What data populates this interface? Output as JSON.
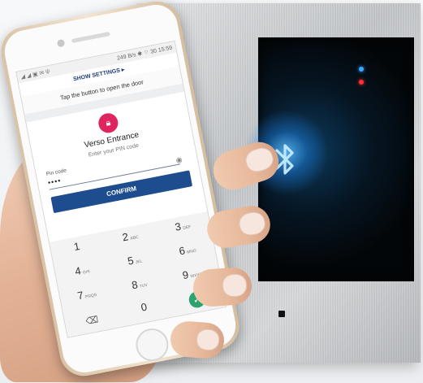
{
  "status_bar": {
    "left_icons": [
      "signal-icon",
      "signal-icon",
      "image-icon",
      "mail-icon",
      "usb-icon"
    ],
    "right_text": "249 B/s ✱ ⌔ 30 15:59"
  },
  "app": {
    "settings_label": "SHOW SETTINGS ▸",
    "instruction": "Tap the button to open the door",
    "entrance_title": "Verso Entrance",
    "entrance_subtitle": "Enter your PIN code",
    "pin_label": "Pin code",
    "pin_value": "••••",
    "confirm_label": "CONFIRM"
  },
  "keypad": [
    {
      "digit": "1",
      "letters": ""
    },
    {
      "digit": "2",
      "letters": "ABC"
    },
    {
      "digit": "3",
      "letters": "DEF"
    },
    {
      "digit": "4",
      "letters": "GHI"
    },
    {
      "digit": "5",
      "letters": "JKL"
    },
    {
      "digit": "6",
      "letters": "MNO"
    },
    {
      "digit": "7",
      "letters": "PRQS"
    },
    {
      "digit": "8",
      "letters": "TUV"
    },
    {
      "digit": "9",
      "letters": "WXYZ"
    },
    {
      "digit": "⌫",
      "letters": ""
    },
    {
      "digit": "0",
      "letters": ""
    },
    {
      "digit": "✓",
      "letters": ""
    }
  ],
  "colors": {
    "brand_blue": "#1e4d8f",
    "lock_pink": "#e0245e",
    "confirm_green": "#2da46e",
    "bluetooth_glow": "#3aa5ff"
  }
}
